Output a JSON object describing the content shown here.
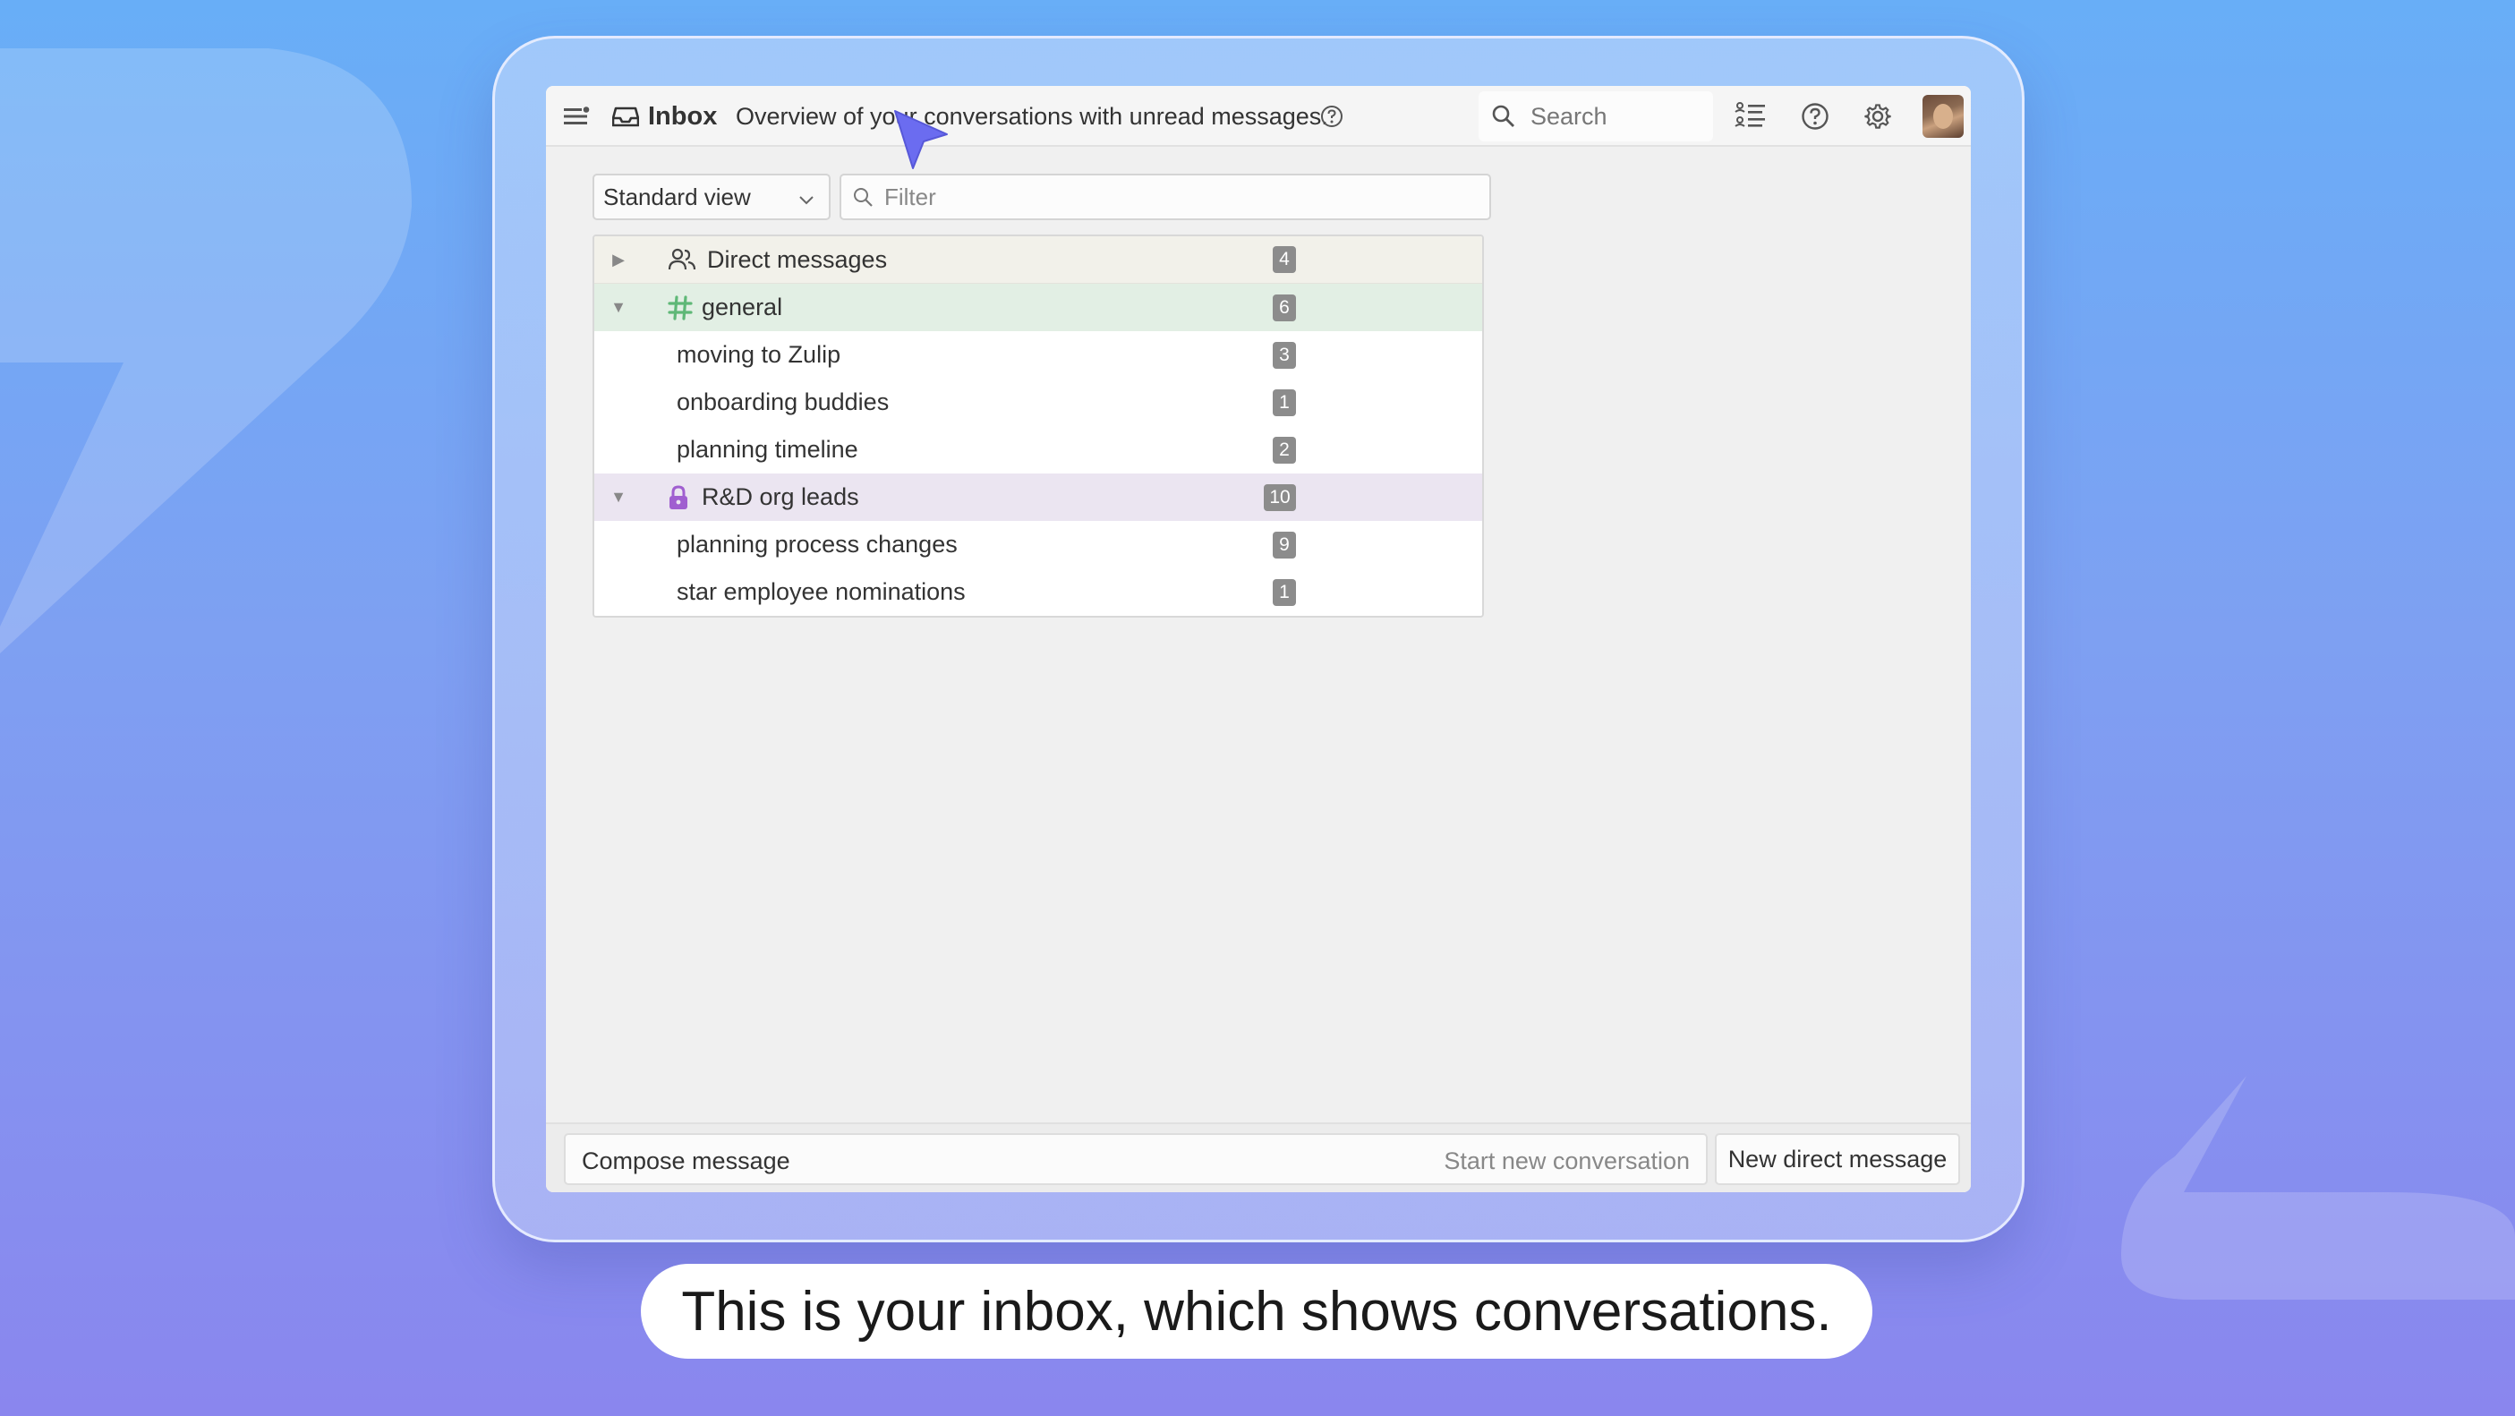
{
  "topbar": {
    "title": "Inbox",
    "subtitle": "Overview of your conversations with unread messages.",
    "search_placeholder": "Search"
  },
  "controls": {
    "view_select": "Standard view",
    "filter_placeholder": "Filter"
  },
  "inbox": {
    "direct_messages": {
      "label": "Direct messages",
      "count": "4"
    },
    "channels": [
      {
        "name": "general",
        "count": "6",
        "icon": "hash-icon",
        "color": "#5fb877",
        "topics": [
          {
            "label": "moving to Zulip",
            "count": "3"
          },
          {
            "label": "onboarding buddies",
            "count": "1"
          },
          {
            "label": "planning timeline",
            "count": "2"
          }
        ]
      },
      {
        "name": "R&D org leads",
        "count": "10",
        "icon": "lock-icon",
        "color": "#a05fd0",
        "topics": [
          {
            "label": "planning process changes",
            "count": "9"
          },
          {
            "label": "star employee nominations",
            "count": "1"
          }
        ]
      }
    ]
  },
  "compose": {
    "compose_label": "Compose message",
    "start_conversation": "Start new conversation",
    "new_direct_message": "New direct message"
  },
  "caption": "This is your inbox, which shows conversations.",
  "colors": {
    "accent_cursor": "#6b6cf0",
    "badge": "#8c8c8c"
  }
}
